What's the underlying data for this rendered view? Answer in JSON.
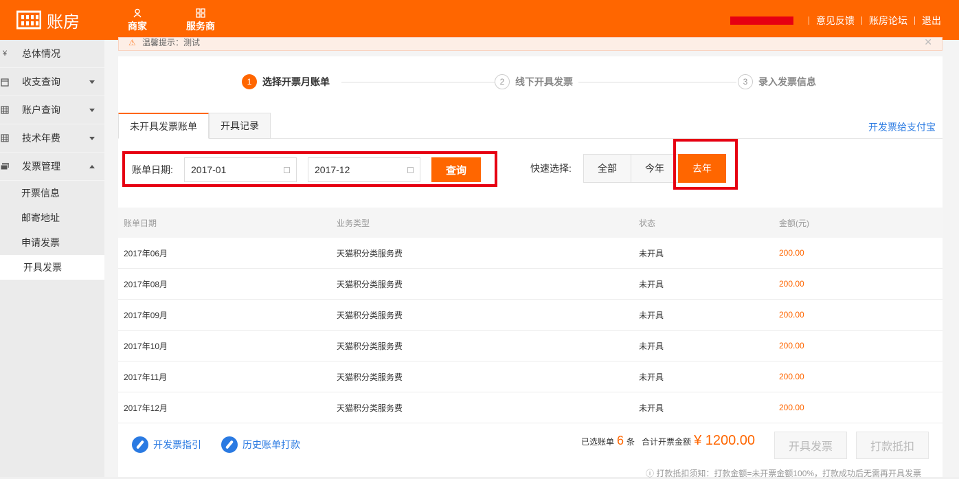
{
  "header": {
    "logo_text": "账房",
    "nav": [
      {
        "label": "商家",
        "icon": "person-icon"
      },
      {
        "label": "服务商",
        "icon": "grid-icon"
      }
    ],
    "links": [
      "意见反馈",
      "账房论坛",
      "退出"
    ]
  },
  "sidebar": {
    "items": [
      {
        "label": "总体情况",
        "icon": "yen-icon"
      },
      {
        "label": "收支查询",
        "icon": "calendar-icon"
      },
      {
        "label": "账户查询",
        "icon": "table-icon"
      },
      {
        "label": "技术年费",
        "icon": "table-icon"
      },
      {
        "label": "发票管理",
        "icon": "cards-icon"
      }
    ],
    "sub_items": [
      "开票信息",
      "邮寄地址",
      "申请发票",
      "开具发票"
    ]
  },
  "notice": {
    "text": "温馨提示：测试"
  },
  "steps": [
    {
      "num": "1",
      "label": "选择开票月账单"
    },
    {
      "num": "2",
      "label": "线下开具发票"
    },
    {
      "num": "3",
      "label": "录入发票信息"
    }
  ],
  "tabs": [
    "未开具发票账单",
    "开具记录"
  ],
  "alipay_link": "开发票给支付宝",
  "filter": {
    "label": "账单日期:",
    "start": "2017-01",
    "end": "2017-12",
    "query_label": "查询",
    "quick_label": "快速选择:",
    "quick_options": [
      "全部",
      "今年",
      "去年"
    ]
  },
  "table": {
    "headers": [
      "账单日期",
      "业务类型",
      "状态",
      "金额(元)"
    ],
    "rows": [
      [
        "2017年06月",
        "天猫积分类服务费",
        "未开具",
        "200.00"
      ],
      [
        "2017年08月",
        "天猫积分类服务费",
        "未开具",
        "200.00"
      ],
      [
        "2017年09月",
        "天猫积分类服务费",
        "未开具",
        "200.00"
      ],
      [
        "2017年10月",
        "天猫积分类服务费",
        "未开具",
        "200.00"
      ],
      [
        "2017年11月",
        "天猫积分类服务费",
        "未开具",
        "200.00"
      ],
      [
        "2017年12月",
        "天猫积分类服务费",
        "未开具",
        "200.00"
      ]
    ]
  },
  "footer": {
    "guide_link": "开发票指引",
    "history_link": "历史账单打款",
    "selected_prefix": "已选账单",
    "selected_count": "6",
    "selected_suffix": "条",
    "total_label": "合计开票金额",
    "total_amount": "¥ 1200.00",
    "issue_btn": "开具发票",
    "deduct_btn": "打款抵扣",
    "note": "ⓘ 打款抵扣须知：打款金额=未开票金额100%，打款成功后无需再开具发票"
  },
  "colors": {
    "accent": "#ff6600",
    "link": "#2a7ae2",
    "highlight": "#e60012"
  }
}
